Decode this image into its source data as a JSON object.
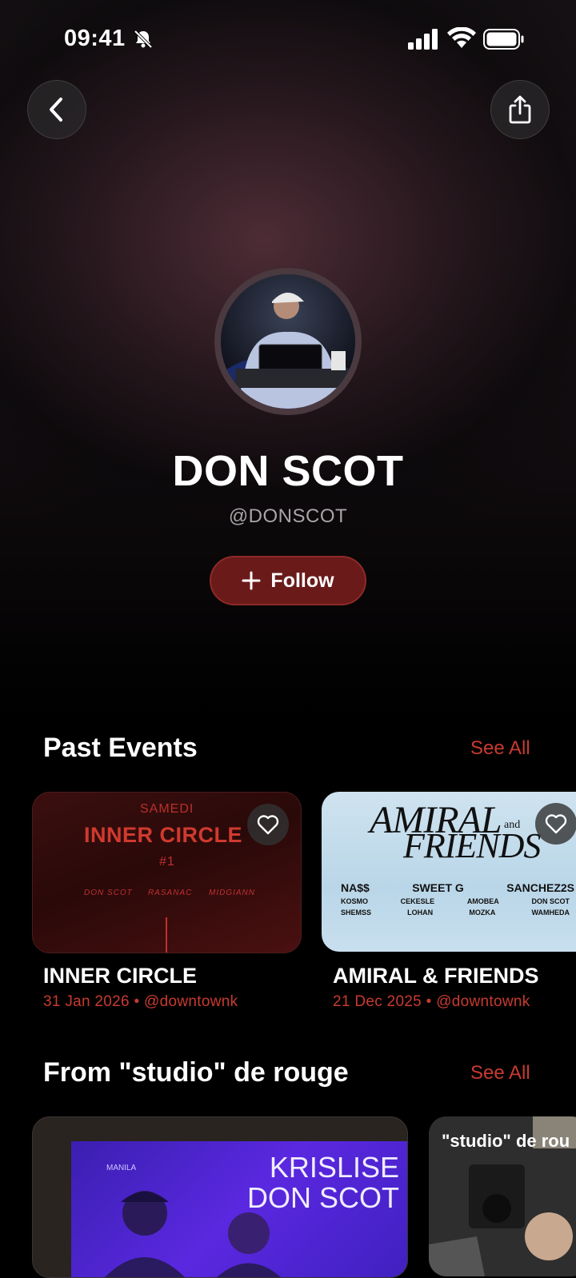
{
  "status": {
    "time": "09:41"
  },
  "artist": {
    "name": "DON SCOT",
    "handle": "@DONSCOT"
  },
  "follow": {
    "label": "Follow"
  },
  "past_events": {
    "title": "Past Events",
    "see_all": "See All",
    "items": [
      {
        "title": "INNER CIRCLE",
        "date": "31 Jan 2026",
        "venue": "@downtownk",
        "poster": {
          "day": "SAMEDI",
          "name": "INNER CIRCLE",
          "number": "#1",
          "lineup": [
            "DON SCOT",
            "RASANAC",
            "MIDGIANN"
          ]
        }
      },
      {
        "title": "AMIRAL & FRIENDS",
        "date": "21 Dec 2025",
        "venue": "@downtownk",
        "poster": {
          "line1": "AMIRAL",
          "and": "and",
          "line2": "FRIENDS",
          "row1": [
            "NA$$",
            "SWEET G",
            "SANCHEZ2S"
          ],
          "row2": [
            "KOSMO",
            "CEKESLE",
            "AMOBEA",
            "DON SCOT"
          ],
          "row3": [
            "SHEMSS",
            "LOHAN",
            "MOZKA",
            "WAMHEDA"
          ]
        }
      }
    ]
  },
  "studio": {
    "title": "From \"studio\" de rouge",
    "see_all": "See All",
    "cards": [
      {
        "line1": "KRISLISE",
        "line2": "DON SCOT",
        "cap_text": "MANILA"
      },
      {
        "label": "\"studio\" de rou"
      }
    ]
  },
  "meta_separator": "•",
  "colors": {
    "accent": "#c83a30",
    "follow_bg": "#6b1a1a"
  }
}
